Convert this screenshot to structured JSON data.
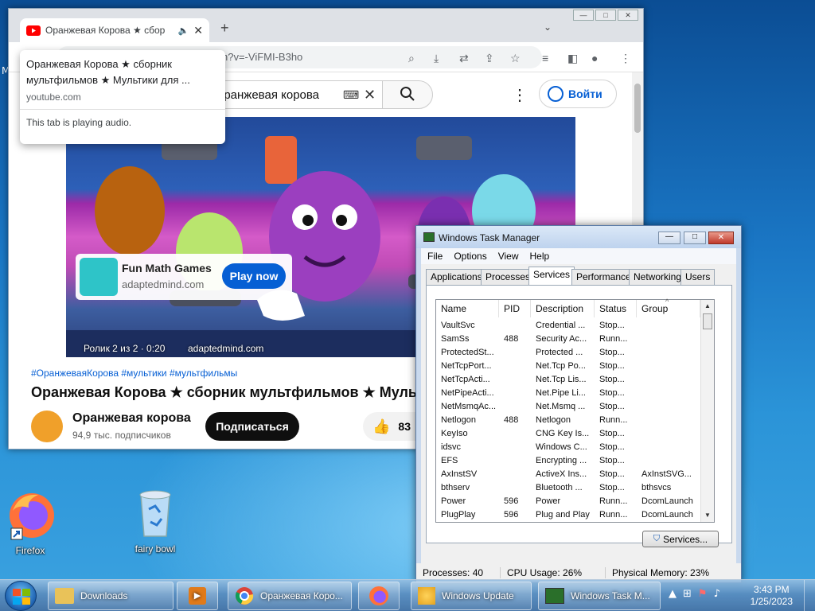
{
  "desktop": {
    "icons": [
      {
        "label": "Firefox",
        "icon": "firefox-icon"
      },
      {
        "label": "fairy bowl",
        "icon": "recycle-bin-icon"
      }
    ],
    "left_edge_label": "M"
  },
  "chrome": {
    "tab": {
      "title": "Оранжевая Корова ★ сбор",
      "favicon": "youtube-icon",
      "audio_icon": "speaker-icon"
    },
    "url": "h?v=-ViFMI-B3ho",
    "tooltip": {
      "title": "Оранжевая Корова ★ сборник мультфильмов ★ Мультики для ...",
      "domain": "youtube.com",
      "status": "This tab is playing audio."
    }
  },
  "youtube": {
    "search_value": "оранжевая корова",
    "signin": "Войти",
    "ad": {
      "name": "Fun Math Games",
      "domain": "adaptedmind.com",
      "cta": "Play now"
    },
    "video_overlay": {
      "progress": "Ролик 2 из 2 · 0:20",
      "link": "adaptedmind.com"
    },
    "tags": "#ОранжеваяКорова #мультики #мультфильмы",
    "title": "Оранжевая Корова ★ сборник мультфильмов ★ Мульти",
    "channel": "Оранжевая корова",
    "subscribers": "94,9 тыс. подписчиков",
    "subscribe": "Подписаться",
    "likes": "83"
  },
  "taskmgr": {
    "title": "Windows Task Manager",
    "menu": [
      "File",
      "Options",
      "View",
      "Help"
    ],
    "tabs": [
      "Applications",
      "Processes",
      "Services",
      "Performance",
      "Networking",
      "Users"
    ],
    "active_tab": "Services",
    "columns": [
      "Name",
      "PID",
      "Description",
      "Status",
      "Group"
    ],
    "rows": [
      [
        "VaultSvc",
        "",
        "Credential ...",
        "Stop...",
        ""
      ],
      [
        "SamSs",
        "488",
        "Security Ac...",
        "Runn...",
        ""
      ],
      [
        "ProtectedSt...",
        "",
        "Protected ...",
        "Stop...",
        ""
      ],
      [
        "NetTcpPort...",
        "",
        "Net.Tcp Po...",
        "Stop...",
        ""
      ],
      [
        "NetTcpActi...",
        "",
        "Net.Tcp Lis...",
        "Stop...",
        ""
      ],
      [
        "NetPipeActi...",
        "",
        "Net.Pipe Li...",
        "Stop...",
        ""
      ],
      [
        "NetMsmqAc...",
        "",
        "Net.Msmq ...",
        "Stop...",
        ""
      ],
      [
        "Netlogon",
        "488",
        "Netlogon",
        "Runn...",
        ""
      ],
      [
        "KeyIso",
        "",
        "CNG Key Is...",
        "Stop...",
        ""
      ],
      [
        "idsvc",
        "",
        "Windows C...",
        "Stop...",
        ""
      ],
      [
        "EFS",
        "",
        "Encrypting ...",
        "Stop...",
        ""
      ],
      [
        "AxInstSV",
        "",
        "ActiveX Ins...",
        "Stop...",
        "AxInstSVG..."
      ],
      [
        "bthserv",
        "",
        "Bluetooth ...",
        "Stop...",
        "bthsvcs"
      ],
      [
        "Power",
        "596",
        "Power",
        "Runn...",
        "DcomLaunch"
      ],
      [
        "PlugPlay",
        "596",
        "Plug and Play",
        "Runn...",
        "DcomLaunch"
      ]
    ],
    "services_button": "Services...",
    "status": {
      "processes": "Processes: 40",
      "cpu": "CPU Usage: 26%",
      "memory": "Physical Memory: 23%"
    }
  },
  "taskbar": {
    "items": [
      {
        "label": "Downloads",
        "icon": "folder-icon"
      },
      {
        "label": "",
        "icon": "media-player-icon"
      },
      {
        "label": "Оранжевая Коро...",
        "icon": "chrome-icon"
      },
      {
        "label": "",
        "icon": "firefox-icon"
      },
      {
        "label": "Windows Update",
        "icon": "windows-update-icon"
      },
      {
        "label": "Windows Task M...",
        "icon": "task-manager-icon"
      }
    ],
    "time": "3:43 PM",
    "date": "1/25/2023"
  }
}
